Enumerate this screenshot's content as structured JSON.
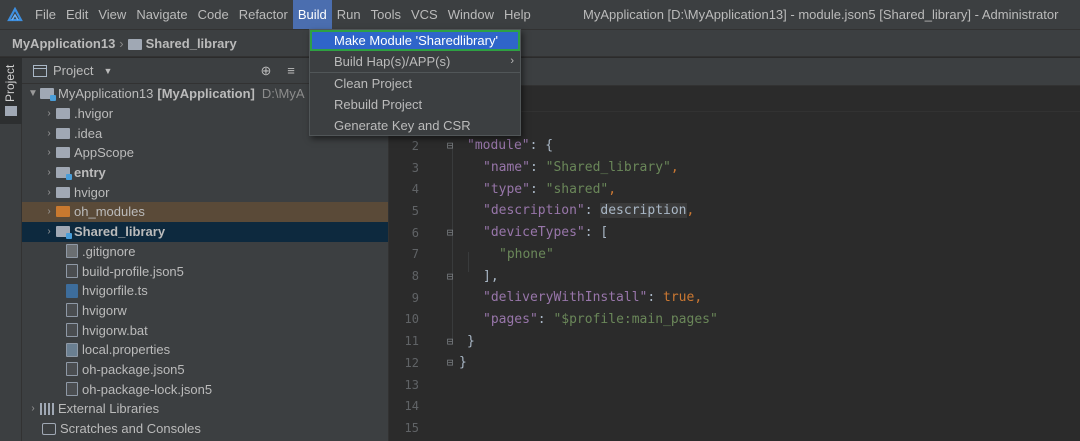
{
  "menubar": {
    "items": [
      "File",
      "Edit",
      "View",
      "Navigate",
      "Code",
      "Refactor",
      "Build",
      "Run",
      "Tools",
      "VCS",
      "Window",
      "Help"
    ],
    "active": "Build",
    "window_title": "MyApplication [D:\\MyApplication13] - module.json5 [Shared_library] - Administrator"
  },
  "breadcrumb": {
    "project": "MyApplication13",
    "module": "Shared_library"
  },
  "tool_stripe": {
    "project_label": "Project"
  },
  "project_panel": {
    "title": "Project",
    "root": {
      "name": "MyApplication13",
      "module": "[MyApplication]",
      "path": "D:\\MyA"
    },
    "items": [
      {
        "name": ".hvigor"
      },
      {
        "name": ".idea"
      },
      {
        "name": "AppScope"
      },
      {
        "name": "entry"
      },
      {
        "name": "hvigor"
      },
      {
        "name": "oh_modules"
      },
      {
        "name": "Shared_library"
      },
      {
        "name": ".gitignore"
      },
      {
        "name": "build-profile.json5"
      },
      {
        "name": "hvigorfile.ts"
      },
      {
        "name": "hvigorw"
      },
      {
        "name": "hvigorw.bat"
      },
      {
        "name": "local.properties"
      },
      {
        "name": "oh-package.json5"
      },
      {
        "name": "oh-package-lock.json5"
      }
    ],
    "external_libraries": "External Libraries",
    "scratches": "Scratches and Consoles"
  },
  "build_menu": {
    "items": [
      {
        "label": "Make Module 'Sharedlibrary'"
      },
      {
        "label": "Build Hap(s)/APP(s)"
      },
      {
        "label": "Clean Project"
      },
      {
        "label": "Rebuild Project"
      },
      {
        "label": "Generate Key and CSR"
      }
    ]
  },
  "editor": {
    "line_numbers": [
      "2",
      "3",
      "4",
      "5",
      "6",
      "7",
      "8",
      "9",
      "10",
      "11",
      "12",
      "13",
      "14",
      "15"
    ],
    "lines": {
      "l2_key": "\"module\"",
      "l2_rest": ": {",
      "l3_key": "\"name\"",
      "l3_val": "\"Shared_library\"",
      "l4_key": "\"type\"",
      "l4_val": "\"shared\"",
      "l5_key": "\"description\"",
      "l5_val": "description",
      "l6_key": "\"deviceTypes\"",
      "l6_rest": ": [",
      "l7_val": "\"phone\"",
      "l8": "],",
      "l9_key": "\"deliveryWithInstall\"",
      "l9_val": "true",
      "l10_key": "\"pages\"",
      "l10_val": "\"$profile:main_pages\"",
      "l11": "}",
      "l12": "}"
    }
  }
}
